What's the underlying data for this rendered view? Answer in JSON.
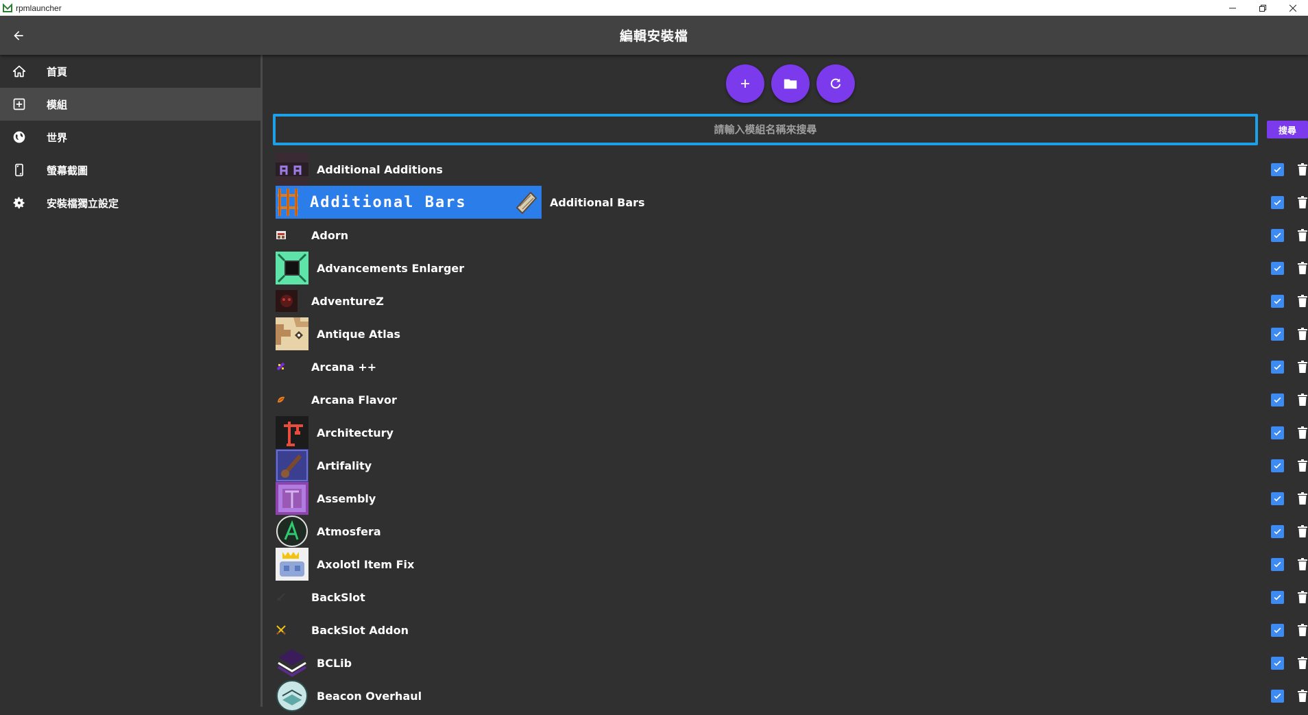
{
  "window": {
    "app_name": "rpmlauncher"
  },
  "header": {
    "title": "編輯安裝檔"
  },
  "sidebar": {
    "items": [
      {
        "label": "首頁",
        "icon": "home-icon"
      },
      {
        "label": "模組",
        "icon": "add-box-icon",
        "active": true
      },
      {
        "label": "世界",
        "icon": "globe-icon"
      },
      {
        "label": "螢幕截圖",
        "icon": "screenshot-icon"
      },
      {
        "label": "安裝檔獨立設定",
        "icon": "gear-icon"
      }
    ]
  },
  "actions": {
    "add": "plus-icon",
    "open_folder": "folder-icon",
    "refresh": "refresh-icon"
  },
  "search": {
    "placeholder": "請輸入模組名稱來搜尋",
    "value": "",
    "button_label": "搜尋"
  },
  "accent": "#7c3aed",
  "focus_color": "#1ea0e6",
  "mods": [
    {
      "name": "Additional Additions",
      "enabled": true,
      "icon": "aa-letters-icon"
    },
    {
      "name": "Additional Bars",
      "enabled": true,
      "icon": "additional-bars-banner",
      "banner_text": "Additional Bars"
    },
    {
      "name": "Adorn",
      "enabled": true,
      "icon": "adorn-icon"
    },
    {
      "name": "Advancements Enlarger",
      "enabled": true,
      "icon": "advancements-enlarger-icon"
    },
    {
      "name": "AdventureZ",
      "enabled": true,
      "icon": "adventurez-icon"
    },
    {
      "name": "Antique Atlas",
      "enabled": true,
      "icon": "antique-atlas-icon"
    },
    {
      "name": "Arcana ++",
      "enabled": true,
      "icon": "arcana-icon"
    },
    {
      "name": "Arcana Flavor",
      "enabled": true,
      "icon": "arcana-flavor-icon"
    },
    {
      "name": "Architectury",
      "enabled": true,
      "icon": "architectury-icon"
    },
    {
      "name": "Artifality",
      "enabled": true,
      "icon": "artifality-icon"
    },
    {
      "name": "Assembly",
      "enabled": true,
      "icon": "assembly-icon"
    },
    {
      "name": "Atmosfera",
      "enabled": true,
      "icon": "atmosfera-icon"
    },
    {
      "name": "Axolotl Item Fix",
      "enabled": true,
      "icon": "axolotl-icon"
    },
    {
      "name": "BackSlot",
      "enabled": true,
      "icon": "backslot-icon"
    },
    {
      "name": "BackSlot Addon",
      "enabled": true,
      "icon": "backslot-addon-icon"
    },
    {
      "name": "BCLib",
      "enabled": true,
      "icon": "bclib-icon"
    },
    {
      "name": "Beacon Overhaul",
      "enabled": true,
      "icon": "beacon-overhaul-icon"
    }
  ]
}
